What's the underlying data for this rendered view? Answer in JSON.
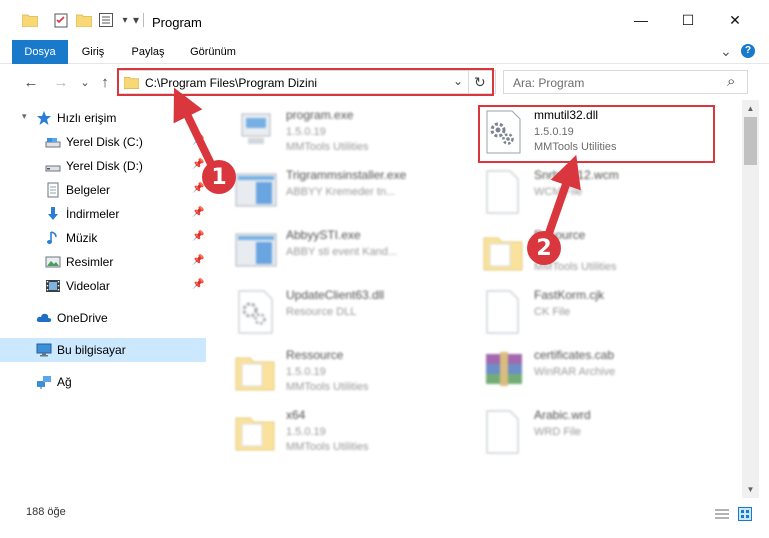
{
  "window": {
    "title": "Program",
    "minimize_glyph": "—",
    "maximize_glyph": "☐",
    "close_glyph": "✕"
  },
  "ribbon": {
    "tabs": [
      "Dosya",
      "Giriş",
      "Paylaş",
      "Görünüm"
    ],
    "expand_glyph": "⌄",
    "help_glyph": "?"
  },
  "navigation": {
    "back_glyph": "←",
    "forward_glyph": "→",
    "recent_glyph": "⌄",
    "up_glyph": "↑",
    "address": "C:\\Program Files\\Program Dizini",
    "address_dropdown_glyph": "⌄",
    "refresh_glyph": "↻",
    "search_placeholder": "Ara: Program",
    "search_glyph": "⌕"
  },
  "sidebar": {
    "quick_access": "Hızlı erişim",
    "items": [
      {
        "label": "Yerel Disk (C:)",
        "icon": "drive-icon",
        "pinned": true
      },
      {
        "label": "Yerel Disk (D:)",
        "icon": "drive-icon",
        "pinned": true
      },
      {
        "label": "Belgeler",
        "icon": "documents-icon",
        "pinned": true
      },
      {
        "label": "İndirmeler",
        "icon": "download-icon",
        "pinned": true
      },
      {
        "label": "Müzik",
        "icon": "music-icon",
        "pinned": true
      },
      {
        "label": "Resimler",
        "icon": "pictures-icon",
        "pinned": true
      },
      {
        "label": "Videolar",
        "icon": "videos-icon",
        "pinned": true
      }
    ],
    "onedrive": "OneDrive",
    "this_pc": "Bu bilgisayar",
    "network": "Ağ",
    "pin_glyph": "📌"
  },
  "files": [
    {
      "name": "program.exe",
      "line2": "1.5.0.19",
      "line3": "MMTools Utilities",
      "icon": "exe-icon",
      "blurred": true
    },
    {
      "name": "mmutil32.dll",
      "line2": "1.5.0.19",
      "line3": "MMTools Utilities",
      "icon": "dll-gear-icon",
      "blurred": false
    },
    {
      "name": "Trigrammsinstaller.exe",
      "line2": "ABBYY Kremeder tn...",
      "line3": "",
      "icon": "window-icon",
      "blurred": true
    },
    {
      "name": "Snrh...P12.wcm",
      "line2": "WCM File",
      "line3": "",
      "icon": "blank-file-icon",
      "blurred": true
    },
    {
      "name": "AbbyySTI.exe",
      "line2": "ABBY sti event Kand...",
      "line3": "",
      "icon": "window-icon",
      "blurred": true
    },
    {
      "name": "Resource",
      "line2": "",
      "line3": "MMTools Utilities",
      "icon": "folder-doc-icon",
      "blurred": true
    },
    {
      "name": "UpdateClient63.dll",
      "line2": "Resource DLL",
      "line3": "",
      "icon": "dll-gear-icon",
      "blurred": true
    },
    {
      "name": "FastKorm.cjk",
      "line2": "CK File",
      "line3": "",
      "icon": "blank-file-icon",
      "blurred": true
    },
    {
      "name": "Ressource",
      "line2": "1.5.0.19",
      "line3": "MMTools Utilities",
      "icon": "folder-doc-icon",
      "blurred": true
    },
    {
      "name": "certificates.cab",
      "line2": "WinRAR Archive",
      "line3": "",
      "icon": "winrar-icon",
      "blurred": true
    },
    {
      "name": "x64",
      "line2": "1.5.0.19",
      "line3": "MMTools Utilities",
      "icon": "folder-doc-icon",
      "blurred": true
    },
    {
      "name": "Arabic.wrd",
      "line2": "WRD File",
      "line3": "",
      "icon": "blank-file-icon",
      "blurred": true
    }
  ],
  "status": {
    "item_count": "188 öğe"
  },
  "annotations": {
    "step1": "1",
    "step2": "2",
    "color": "#d9363e"
  },
  "colors": {
    "ribbon_active": "#1979ca",
    "selected_bg": "#cce8ff",
    "folder": "#f8d775",
    "highlight": "#d9363e"
  }
}
